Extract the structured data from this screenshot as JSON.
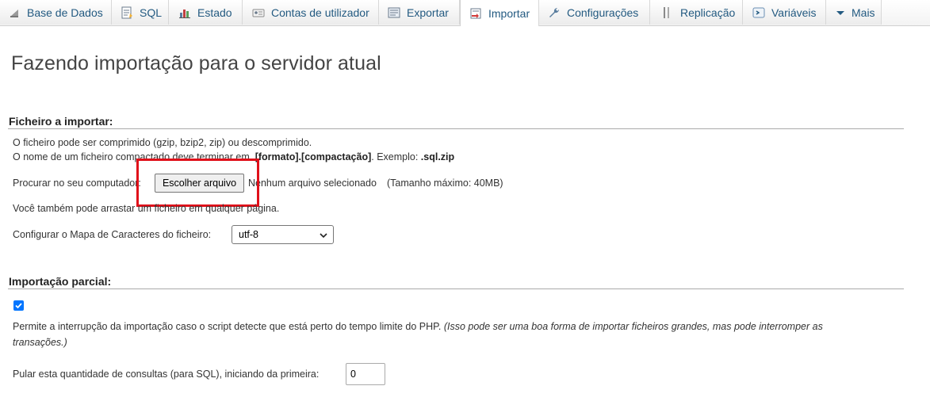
{
  "tabs": [
    {
      "label": "Base de Dados",
      "icon": "database-icon"
    },
    {
      "label": "SQL",
      "icon": "sql-icon"
    },
    {
      "label": "Estado",
      "icon": "status-icon"
    },
    {
      "label": "Contas de utilizador",
      "icon": "user-accounts-icon"
    },
    {
      "label": "Exportar",
      "icon": "export-icon"
    },
    {
      "label": "Importar",
      "icon": "import-icon",
      "active": true
    },
    {
      "label": "Configurações",
      "icon": "wrench-icon"
    },
    {
      "label": "Replicação",
      "icon": "replication-icon"
    },
    {
      "label": "Variáveis",
      "icon": "variables-icon"
    },
    {
      "label": "Mais",
      "icon": "caret-down-icon"
    }
  ],
  "page": {
    "title": "Fazendo importação para o servidor atual"
  },
  "file_section": {
    "legend": "Ficheiro a importar:",
    "line1": "O ficheiro pode ser comprimido (gzip, bzip2, zip) ou descomprimido.",
    "line2_prefix": "O nome de um ficheiro compactado deve terminar em ",
    "line2_bold": ".[formato].[compactação]",
    "line2_mid": ". Exemplo: ",
    "line2_example": ".sql.zip",
    "browse_label": "Procurar no seu computador:",
    "choose_button": "Escolher arquivo",
    "no_file": "Nenhum arquivo selecionado",
    "max_size": "(Tamanho máximo: 40MB)",
    "drag_text": "Você também pode arrastar um ficheiro em qualquer página.",
    "charset_label": "Configurar o Mapa de Caracteres do ficheiro:",
    "charset_value": "utf-8"
  },
  "partial_section": {
    "legend": "Importação parcial:",
    "allow_interrupt_checked": true,
    "allow_interrupt_text": "Permite a interrupção da importação caso o script detecte que está perto do tempo limite do PHP.",
    "allow_interrupt_note": "(Isso pode ser uma boa forma de importar ficheiros grandes, mas pode interromper as",
    "allow_interrupt_note2": "transações.)",
    "skip_label": "Pular esta quantidade de consultas (para SQL), iniciando da primeira:",
    "skip_value": "0"
  },
  "colors": {
    "tab_text": "#235a81",
    "highlight": "#e0101a",
    "checkbox": "#0075ff"
  }
}
